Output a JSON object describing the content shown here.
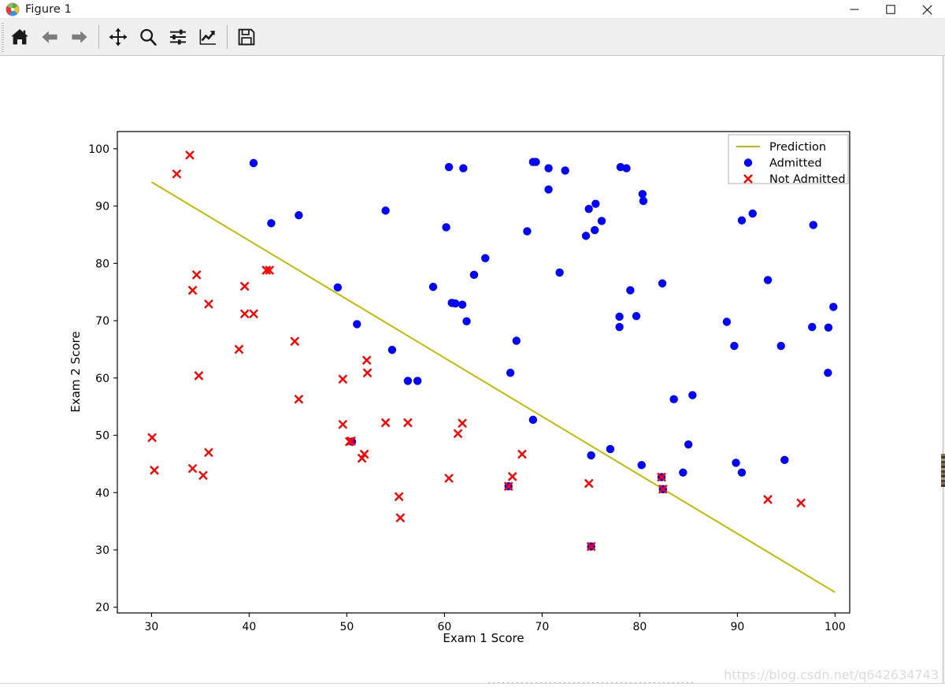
{
  "window": {
    "title": "Figure 1",
    "icon": "matplotlib-figure-icon",
    "minimize_label": "—",
    "maximize_label": "□",
    "close_label": "✕"
  },
  "toolbar": {
    "buttons": [
      {
        "name": "home-icon",
        "tooltip": "Reset original view"
      },
      {
        "name": "back-arrow-icon",
        "tooltip": "Back to previous view"
      },
      {
        "name": "forward-arrow-icon",
        "tooltip": "Forward to next view"
      },
      {
        "name": "pan-move-icon",
        "tooltip": "Pan axes with left mouse, zoom with right"
      },
      {
        "name": "zoom-magnifier-icon",
        "tooltip": "Zoom to rectangle"
      },
      {
        "name": "configure-subplots-icon",
        "tooltip": "Configure subplots"
      },
      {
        "name": "edit-axis-curve-icon",
        "tooltip": "Edit axis, curve and image parameters"
      },
      {
        "name": "save-floppy-icon",
        "tooltip": "Save the figure"
      }
    ]
  },
  "watermark": "https://blog.csdn.net/q642634743",
  "chart_data": {
    "type": "scatter",
    "title": "",
    "xlabel": "Exam 1 Score",
    "ylabel": "Exam 2 Score",
    "xlim": [
      26.5,
      101.5
    ],
    "ylim": [
      19.0,
      103.0
    ],
    "xticks": [
      30,
      40,
      50,
      60,
      70,
      80,
      90,
      100
    ],
    "yticks": [
      20,
      30,
      40,
      50,
      60,
      70,
      80,
      90,
      100
    ],
    "grid": false,
    "legend": {
      "position": "upper right",
      "entries": [
        {
          "label": "Prediction",
          "marker": "line",
          "color": "#bfbf00"
        },
        {
          "label": "Admitted",
          "marker": "circle",
          "color": "#0000ff"
        },
        {
          "label": "Not Admitted",
          "marker": "x",
          "color": "#ff0000"
        }
      ]
    },
    "series": [
      {
        "name": "Prediction",
        "type": "line",
        "color": "#bfbf00",
        "linewidth": 2,
        "x": [
          30.0,
          100.0
        ],
        "y": [
          94.2,
          22.6
        ]
      },
      {
        "name": "Admitted",
        "type": "scatter",
        "marker": "circle",
        "color": "#0000ff",
        "points": [
          [
            40.45,
            97.5
          ],
          [
            42.26,
            87.0
          ],
          [
            45.08,
            88.4
          ],
          [
            49.07,
            75.8
          ],
          [
            50.53,
            48.9
          ],
          [
            51.04,
            69.4
          ],
          [
            53.97,
            89.2
          ],
          [
            54.64,
            64.9
          ],
          [
            56.25,
            59.5
          ],
          [
            57.24,
            59.5
          ],
          [
            58.84,
            75.9
          ],
          [
            60.18,
            86.3
          ],
          [
            60.46,
            96.8
          ],
          [
            60.75,
            73.1
          ],
          [
            61.11,
            73.0
          ],
          [
            61.83,
            72.8
          ],
          [
            61.93,
            96.6
          ],
          [
            62.27,
            69.9
          ],
          [
            63.03,
            78.0
          ],
          [
            64.18,
            80.9
          ],
          [
            66.56,
            41.1
          ],
          [
            66.75,
            60.9
          ],
          [
            67.37,
            66.5
          ],
          [
            68.47,
            85.6
          ],
          [
            69.07,
            97.7
          ],
          [
            69.36,
            97.7
          ],
          [
            69.07,
            52.7
          ],
          [
            70.66,
            92.9
          ],
          [
            70.66,
            96.6
          ],
          [
            71.79,
            78.4
          ],
          [
            72.36,
            96.2
          ],
          [
            74.49,
            84.8
          ],
          [
            75.02,
            46.5
          ],
          [
            75.39,
            85.8
          ],
          [
            75.02,
            30.6
          ],
          [
            74.78,
            89.5
          ],
          [
            75.48,
            90.4
          ],
          [
            76.1,
            87.4
          ],
          [
            76.98,
            47.6
          ],
          [
            77.92,
            68.9
          ],
          [
            78.03,
            96.8
          ],
          [
            77.92,
            70.7
          ],
          [
            78.64,
            96.6
          ],
          [
            79.03,
            75.3
          ],
          [
            79.65,
            70.8
          ],
          [
            80.19,
            44.8
          ],
          [
            80.28,
            92.1
          ],
          [
            80.37,
            90.9
          ],
          [
            82.31,
            76.5
          ],
          [
            82.37,
            40.6
          ],
          [
            82.23,
            42.7
          ],
          [
            83.49,
            56.3
          ],
          [
            84.43,
            43.5
          ],
          [
            85.4,
            57.0
          ],
          [
            84.98,
            48.4
          ],
          [
            88.91,
            69.8
          ],
          [
            89.68,
            65.6
          ],
          [
            89.85,
            45.2
          ],
          [
            90.45,
            87.5
          ],
          [
            90.45,
            43.5
          ],
          [
            91.56,
            88.7
          ],
          [
            93.12,
            77.1
          ],
          [
            94.46,
            65.6
          ],
          [
            94.83,
            45.7
          ],
          [
            97.65,
            68.9
          ],
          [
            97.77,
            86.7
          ],
          [
            99.27,
            60.9
          ],
          [
            99.32,
            68.8
          ],
          [
            99.83,
            72.4
          ]
        ]
      },
      {
        "name": "Not Admitted",
        "type": "scatter",
        "marker": "x",
        "color": "#ff0000",
        "points": [
          [
            30.29,
            43.9
          ],
          [
            30.06,
            49.6
          ],
          [
            32.58,
            95.6
          ],
          [
            33.92,
            98.9
          ],
          [
            34.21,
            44.2
          ],
          [
            34.62,
            78.0
          ],
          [
            34.21,
            75.3
          ],
          [
            34.84,
            60.4
          ],
          [
            35.29,
            43.0
          ],
          [
            35.85,
            72.9
          ],
          [
            35.85,
            47.0
          ],
          [
            38.96,
            65.0
          ],
          [
            39.54,
            76.0
          ],
          [
            39.54,
            71.2
          ],
          [
            40.46,
            71.2
          ],
          [
            41.76,
            78.8
          ],
          [
            42.08,
            78.8
          ],
          [
            44.67,
            66.4
          ],
          [
            45.08,
            56.3
          ],
          [
            49.59,
            51.9
          ],
          [
            49.59,
            59.8
          ],
          [
            50.46,
            49.0
          ],
          [
            50.28,
            48.9
          ],
          [
            51.55,
            46.0
          ],
          [
            51.79,
            46.7
          ],
          [
            52.04,
            63.1
          ],
          [
            52.11,
            60.9
          ],
          [
            53.97,
            52.2
          ],
          [
            55.48,
            35.6
          ],
          [
            55.34,
            39.3
          ],
          [
            56.25,
            52.2
          ],
          [
            60.46,
            42.5
          ],
          [
            61.38,
            50.3
          ],
          [
            61.83,
            52.1
          ],
          [
            66.56,
            41.1
          ],
          [
            66.96,
            42.8
          ],
          [
            67.95,
            46.7
          ],
          [
            74.79,
            41.6
          ],
          [
            75.02,
            30.6
          ],
          [
            82.23,
            42.7
          ],
          [
            82.37,
            40.6
          ],
          [
            93.12,
            38.8
          ],
          [
            96.51,
            38.2
          ]
        ]
      }
    ]
  }
}
